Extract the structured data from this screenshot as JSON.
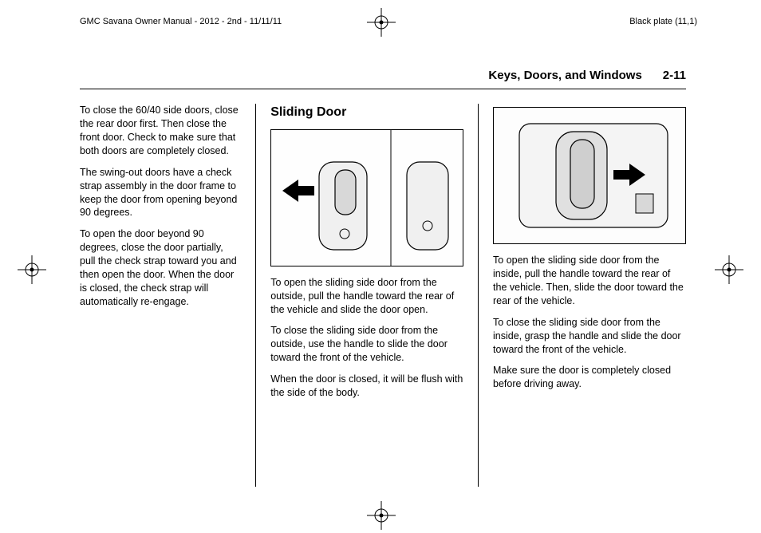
{
  "meta": {
    "doc_title": "GMC Savana Owner Manual - 2012 - 2nd - 11/11/11",
    "plate": "Black plate (11,1)"
  },
  "header": {
    "section": "Keys, Doors, and Windows",
    "page_num": "2-11"
  },
  "col1": {
    "p1": "To close the 60/40 side doors, close the rear door first. Then close the front door. Check to make sure that both doors are completely closed.",
    "p2": "The swing-out doors have a check strap assembly in the door frame to keep the door from opening beyond 90 degrees.",
    "p3": "To open the door beyond 90 degrees, close the door partially, pull the check strap toward you and then open the door. When the door is closed, the check strap will automatically re-engage."
  },
  "col2": {
    "heading": "Sliding Door",
    "p1": "To open the sliding side door from the outside, pull the handle toward the rear of the vehicle and slide the door open.",
    "p2": "To close the sliding side door from the outside, use the handle to slide the door toward the front of the vehicle.",
    "p3": "When the door is closed, it will be flush with the side of the body."
  },
  "col3": {
    "p1": "To open the sliding side door from the inside, pull the handle toward the rear of the vehicle. Then, slide the door toward the rear of the vehicle.",
    "p2": "To close the sliding side door from the inside, grasp the handle and slide the door toward the front of the vehicle.",
    "p3": "Make sure the door is completely closed before driving away."
  }
}
